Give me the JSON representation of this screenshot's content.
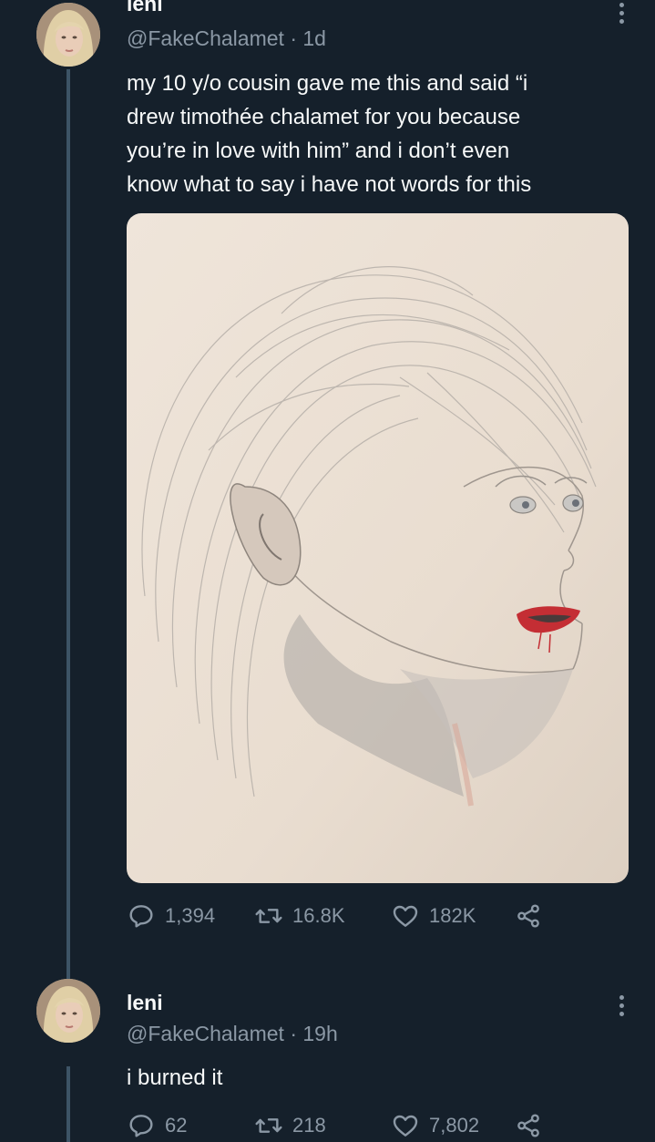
{
  "tweets": [
    {
      "name": "leni",
      "handle": "@FakeChalamet",
      "time": "1d",
      "text_lines": [
        "my 10 y/o cousin gave me this and said “i",
        "drew timothée chalamet for you because",
        "you’re in love with him” and i don’t even",
        "know what to say i have not words for this"
      ],
      "replies": "1,394",
      "retweets": "16.8K",
      "likes": "182K"
    },
    {
      "name": "leni",
      "handle": "@FakeChalamet",
      "time": "19h",
      "text_lines": [
        "i burned it"
      ],
      "replies": "62",
      "retweets": "218",
      "likes": "7,802"
    }
  ],
  "separator": "·",
  "icons": [
    "reply-icon",
    "retweet-icon",
    "like-icon",
    "share-icon",
    "more-icon"
  ],
  "colors": {
    "background": "#15202b",
    "text": "#f7f9f9",
    "secondary_text": "#8b98a5",
    "thread_line": "#3d5466",
    "paper": "#ece1d6"
  }
}
